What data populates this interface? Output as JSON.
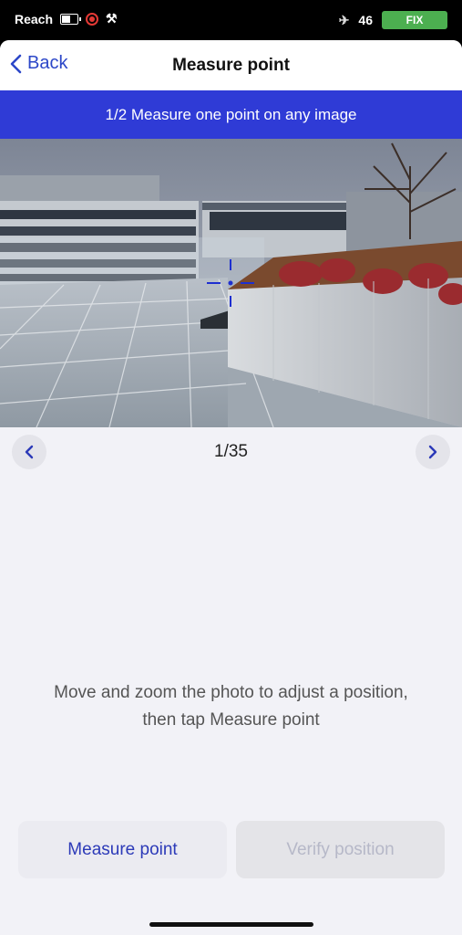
{
  "status_bar": {
    "carrier": "Reach",
    "satellite_count": "46",
    "fix_label": "FIX",
    "fix_color": "#4caf50"
  },
  "nav": {
    "back_label": "Back",
    "title": "Measure point"
  },
  "banner": {
    "text": "1/2 Measure one point on any image",
    "color": "#2f3bd6"
  },
  "pager": {
    "count": "1/35"
  },
  "instruction": "Move and zoom the photo to adjust a position, then tap Measure point",
  "actions": {
    "measure_label": "Measure point",
    "verify_label": "Verify position",
    "accent": "#2c3ab8"
  },
  "icons": [
    "battery-icon",
    "record-icon",
    "tools-icon",
    "satellite-icon",
    "chevron-left-icon",
    "chevron-right-icon",
    "crosshair-icon"
  ]
}
